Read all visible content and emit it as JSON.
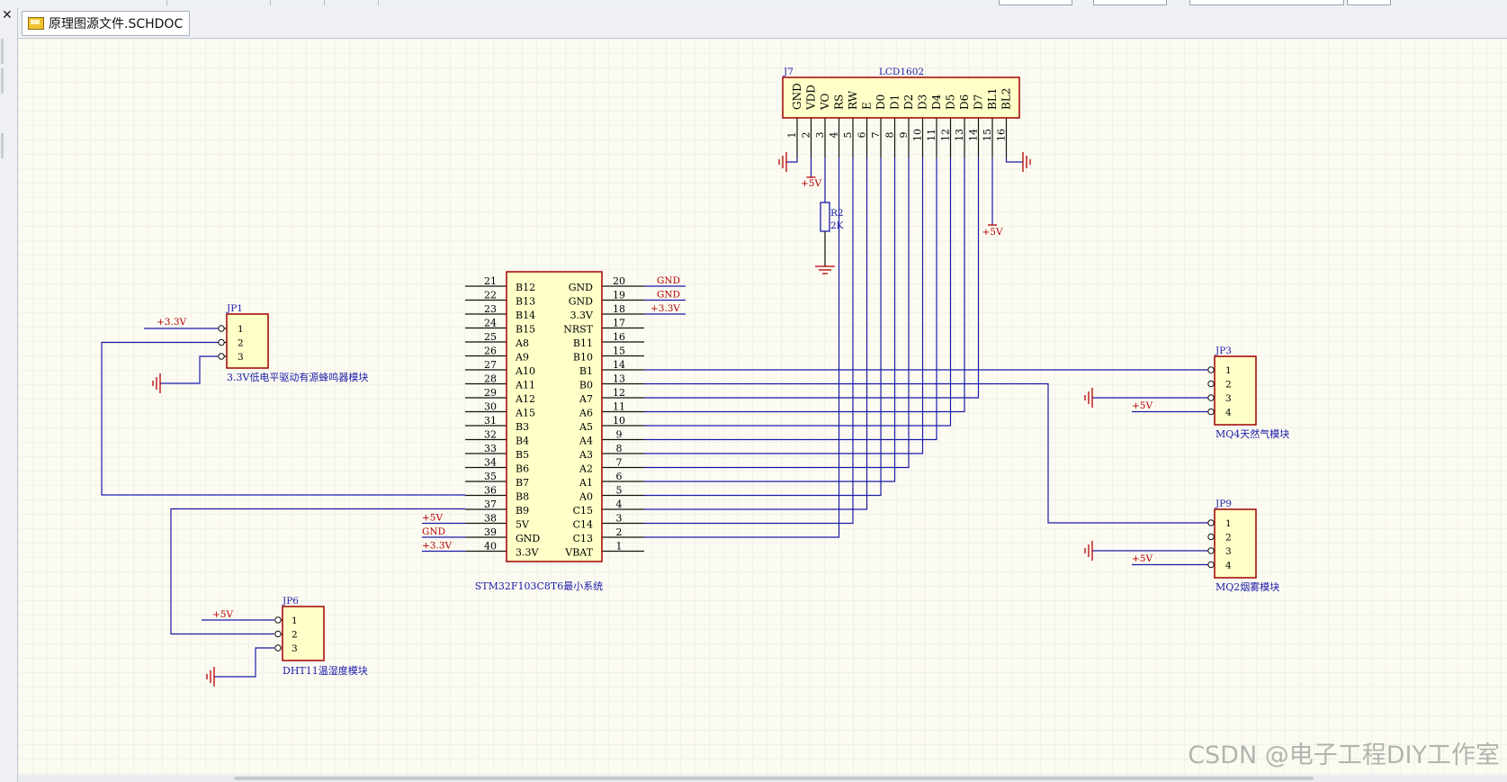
{
  "document_tab": {
    "label": "原理图源文件.SCHDOC",
    "icon": "schematic-doc-icon"
  },
  "toolbar": {
    "close_icon": "close-icon"
  },
  "watermark": "CSDN @电子工程DIY工作室",
  "colors": {
    "sheet_bg": "#fcfbf2",
    "grid": "#e9eae2",
    "wire": "#1a1aa8",
    "pin_text": "#000000",
    "component_fill": "#ffffc8",
    "component_border": "#a00000",
    "power": "#b40000"
  },
  "mcu": {
    "designator": "STM32F103C8T6最小系统",
    "left_pins": [
      {
        "num": "21",
        "name": "B12"
      },
      {
        "num": "22",
        "name": "B13"
      },
      {
        "num": "23",
        "name": "B14"
      },
      {
        "num": "24",
        "name": "B15"
      },
      {
        "num": "25",
        "name": "A8"
      },
      {
        "num": "26",
        "name": "A9"
      },
      {
        "num": "27",
        "name": "A10"
      },
      {
        "num": "28",
        "name": "A11"
      },
      {
        "num": "29",
        "name": "A12"
      },
      {
        "num": "30",
        "name": "A15"
      },
      {
        "num": "31",
        "name": "B3"
      },
      {
        "num": "32",
        "name": "B4"
      },
      {
        "num": "33",
        "name": "B5"
      },
      {
        "num": "34",
        "name": "B6"
      },
      {
        "num": "35",
        "name": "B7"
      },
      {
        "num": "36",
        "name": "B8"
      },
      {
        "num": "37",
        "name": "B9"
      },
      {
        "num": "38",
        "name": "5V"
      },
      {
        "num": "39",
        "name": "GND"
      },
      {
        "num": "40",
        "name": "3.3V"
      }
    ],
    "right_pins": [
      {
        "num": "20",
        "name": "GND"
      },
      {
        "num": "19",
        "name": "GND"
      },
      {
        "num": "18",
        "name": "3.3V"
      },
      {
        "num": "17",
        "name": "NRST"
      },
      {
        "num": "16",
        "name": "B11"
      },
      {
        "num": "15",
        "name": "B10"
      },
      {
        "num": "14",
        "name": "B1"
      },
      {
        "num": "13",
        "name": "B0"
      },
      {
        "num": "12",
        "name": "A7"
      },
      {
        "num": "11",
        "name": "A6"
      },
      {
        "num": "10",
        "name": "A5"
      },
      {
        "num": "9",
        "name": "A4"
      },
      {
        "num": "8",
        "name": "A3"
      },
      {
        "num": "7",
        "name": "A2"
      },
      {
        "num": "6",
        "name": "A1"
      },
      {
        "num": "5",
        "name": "A0"
      },
      {
        "num": "4",
        "name": "C15"
      },
      {
        "num": "3",
        "name": "C14"
      },
      {
        "num": "2",
        "name": "C13"
      },
      {
        "num": "1",
        "name": "VBAT"
      }
    ],
    "net_labels": {
      "pin20": "GND",
      "pin19": "GND",
      "pin18": "+3.3V",
      "pin38": "+5V",
      "pin39": "GND",
      "pin40": "+3.3V"
    }
  },
  "lcd": {
    "ref": "J7",
    "value": "LCD1602",
    "pins": [
      {
        "num": "1",
        "name": "GND"
      },
      {
        "num": "2",
        "name": "VDD"
      },
      {
        "num": "3",
        "name": "VO"
      },
      {
        "num": "4",
        "name": "RS"
      },
      {
        "num": "5",
        "name": "RW"
      },
      {
        "num": "6",
        "name": "E"
      },
      {
        "num": "7",
        "name": "D0"
      },
      {
        "num": "8",
        "name": "D1"
      },
      {
        "num": "9",
        "name": "D2"
      },
      {
        "num": "10",
        "name": "D3"
      },
      {
        "num": "11",
        "name": "D4"
      },
      {
        "num": "12",
        "name": "D5"
      },
      {
        "num": "13",
        "name": "D6"
      },
      {
        "num": "14",
        "name": "D7"
      },
      {
        "num": "15",
        "name": "BL1"
      },
      {
        "num": "16",
        "name": "BL2"
      }
    ],
    "vdd_label": "+5V",
    "bl_label": "+5V"
  },
  "resistor": {
    "ref": "R2",
    "value": "2K"
  },
  "jp1": {
    "ref": "JP1",
    "pins": [
      "1",
      "2",
      "3"
    ],
    "desc": "3.3V低电平驱动有源蜂鸣器模块",
    "power_label": "+3.3V"
  },
  "jp3": {
    "ref": "JP3",
    "pins": [
      "1",
      "2",
      "3",
      "4"
    ],
    "desc": "MQ4天然气模块",
    "power_label": "+5V"
  },
  "jp9": {
    "ref": "JP9",
    "pins": [
      "1",
      "2",
      "3",
      "4"
    ],
    "desc": "MQ2烟雾模块",
    "power_label": "+5V"
  },
  "jp6": {
    "ref": "JP6",
    "pins": [
      "1",
      "2",
      "3"
    ],
    "desc": "DHT11温湿度模块",
    "power_label": "+5V"
  }
}
